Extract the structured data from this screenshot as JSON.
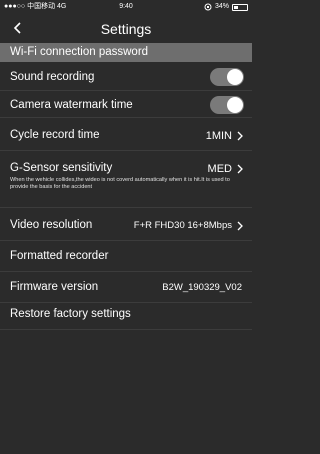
{
  "status_bar": {
    "carrier": "●●●○○ 中国移动  4G",
    "time": "9:40",
    "battery_text": "34%",
    "battery_level": 0.34
  },
  "nav": {
    "title": "Settings"
  },
  "header": {
    "wifi_password": "Wi-Fi connection password"
  },
  "settings": {
    "sound_recording": {
      "label": "Sound recording",
      "enabled": true
    },
    "camera_watermark": {
      "label": "Camera watermark time",
      "enabled": true
    },
    "cycle_record": {
      "label": "Cycle record time",
      "value": "1MIN"
    },
    "gsensor": {
      "label": "G-Sensor sensitivity",
      "value": "MED",
      "note": "When the wehicle collides,the wideo is not coverd automatically when it is hit.It is used to provide the basis for the accident"
    },
    "video_resolution": {
      "label": "Video resolution",
      "value": "F+R FHD30 16+8Mbps"
    },
    "formatted_recorder": {
      "label": "Formatted recorder"
    },
    "firmware": {
      "label": "Firmware version",
      "value": "B2W_190329_V02"
    },
    "restore": {
      "label": "Restore factory settings"
    }
  },
  "colors": {
    "background": "#2b2b2b",
    "header_bg": "#6e6e6e",
    "toggle_on": "#7a7a7a"
  }
}
